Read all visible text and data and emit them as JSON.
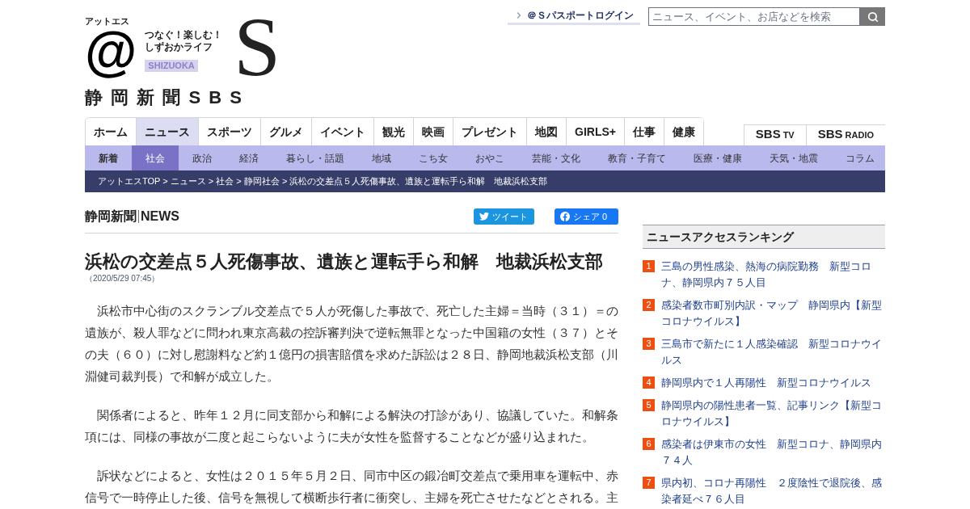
{
  "header": {
    "logo": {
      "katakana": "アットエス",
      "at": "@",
      "tagline_1": "つなぐ！楽しむ！",
      "tagline_2": "しずおかライフ",
      "region": "SHIZUOKA",
      "big_letter": "S",
      "name": "静 岡 新 聞 S B S"
    },
    "login_link": "＠Ｓパスポートログイン",
    "search": {
      "placeholder": "ニュース、イベント、お店などを検索"
    }
  },
  "nav": {
    "tabs": [
      {
        "label": "ホーム",
        "selected": false
      },
      {
        "label": "ニュース",
        "selected": true
      },
      {
        "label": "スポーツ",
        "selected": false
      },
      {
        "label": "グルメ",
        "selected": false
      },
      {
        "label": "イベント",
        "selected": false
      },
      {
        "label": "観光",
        "selected": false
      },
      {
        "label": "映画",
        "selected": false
      },
      {
        "label": "プレゼント",
        "selected": false
      },
      {
        "label": "地図",
        "selected": false
      },
      {
        "label": "GIRLS+",
        "selected": false
      },
      {
        "label": "仕事",
        "selected": false
      },
      {
        "label": "健康",
        "selected": false
      }
    ],
    "media_links": [
      {
        "main": "SBS",
        "sub": "TV"
      },
      {
        "main": "SBS",
        "sub": "RADIO"
      }
    ]
  },
  "subnav": [
    {
      "label": "新着",
      "kind": "latest",
      "selected": false
    },
    {
      "label": "社会",
      "kind": "category",
      "selected": true
    },
    {
      "label": "政治",
      "kind": "category",
      "selected": false
    },
    {
      "label": "経済",
      "kind": "category",
      "selected": false
    },
    {
      "label": "暮らし・話題",
      "kind": "category",
      "selected": false
    },
    {
      "label": "地域",
      "kind": "category",
      "selected": false
    },
    {
      "label": "こち女",
      "kind": "category",
      "selected": false
    },
    {
      "label": "おやこ",
      "kind": "category",
      "selected": false
    },
    {
      "label": "芸能・文化",
      "kind": "category",
      "selected": false
    },
    {
      "label": "教育・子育て",
      "kind": "category",
      "selected": false
    },
    {
      "label": "医療・健康",
      "kind": "category",
      "selected": false
    },
    {
      "label": "天気・地震",
      "kind": "category",
      "selected": false
    },
    {
      "label": "コラム",
      "kind": "category",
      "selected": false
    }
  ],
  "breadcrumb": "アットエスTOP > ニュース > 社会 > 静岡社会 > 浜松の交差点５人死傷事故、遺族と運転手ら和解　地裁浜松支部",
  "article": {
    "section_label": {
      "paper": "静岡新聞",
      "tag": "NEWS"
    },
    "share_buttons": [
      {
        "kind": "tweet",
        "label": "ツイート"
      },
      {
        "kind": "share",
        "label": "シェア 0"
      }
    ],
    "title": "浜松の交差点５人死傷事故、遺族と運転手ら和解　地裁浜松支部",
    "date": "（2020/5/29 07:45）",
    "paragraphs": [
      "浜松市中心街のスクランブル交差点で５人が死傷した事故で、死亡した主婦＝当時（３１）＝の遺族が、殺人罪などに問われ東京高裁の控訴審判決で逆転無罪となった中国籍の女性（３７）とその夫（６０）に対し慰謝料など約１億円の損害賠償を求めた訴訟は２８日、静岡地裁浜松支部（川淵健司裁判長）で和解が成立した。",
      "関係者によると、昨年１２月に同支部から和解による解決の打診があり、協議していた。和解条項には、同様の事故が二度と起こらないように夫が女性を監督することなどが盛り込まれた。",
      "訴状などによると、女性は２０１５年５月２日、同市中区の鍛冶町交差点で乗用車を運転中、赤信号で一時停止した後、信号を無視して横断歩行者に衝突し、主婦を死亡させたなどとされる。主"
    ]
  },
  "ranking": {
    "title": "ニュースアクセスランキング",
    "items": [
      {
        "rank": "1",
        "text": "三島の男性感染、熱海の病院勤務　新型コロナ、静岡県内７５人目"
      },
      {
        "rank": "2",
        "text": "感染者数市町別内訳・マップ　静岡県内【新型コロナウイルス】"
      },
      {
        "rank": "3",
        "text": "三島市で新たに１人感染確認　新型コロナウイルス"
      },
      {
        "rank": "4",
        "text": "静岡県内で１人再陽性　新型コロナウイルス"
      },
      {
        "rank": "5",
        "text": "静岡県内の陽性患者一覧、記事リンク【新型コロナウイルス】"
      },
      {
        "rank": "6",
        "text": "感染者は伊東市の女性　新型コロナ、静岡県内７４人"
      },
      {
        "rank": "7",
        "text": "県内初、コロナ再陽性　２度陰性で退院後、感染者延べ７６人目"
      }
    ]
  }
}
